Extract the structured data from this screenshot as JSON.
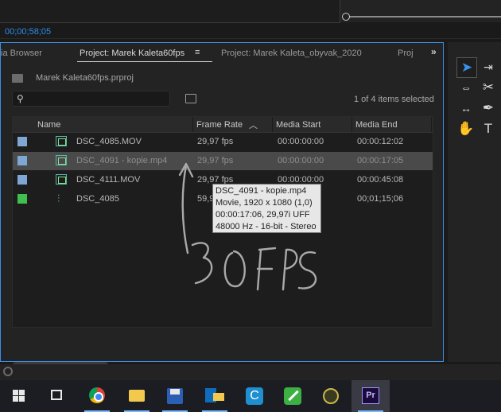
{
  "monitor": {
    "timecode": "00;00;58;05"
  },
  "project_panel": {
    "tabs": [
      {
        "label": "ia Browser"
      },
      {
        "label": "Project: Marek Kaleta60fps"
      },
      {
        "label": "Project: Marek Kaleta_obyvak_2020"
      },
      {
        "label": "Proj"
      }
    ],
    "tab_menu_glyph": "≡",
    "more_glyph": "»",
    "project_file": "Marek Kaleta60fps.prproj",
    "search_placeholder": "",
    "items_selected": "1 of 4 items selected",
    "columns": [
      "Name",
      "Frame Rate",
      "Media Start",
      "Media End"
    ],
    "sort_indicator": "^",
    "rows": [
      {
        "color": "#7fa7d6",
        "icon": "video-clip-icon",
        "name": "DSC_4085.MOV",
        "frame_rate": "29,97 fps",
        "media_start": "00:00:00:00",
        "media_end": "00:00:12:02",
        "selected": false
      },
      {
        "color": "#7fa7d6",
        "icon": "video-clip-icon",
        "name": "DSC_4091 - kopie.mp4",
        "frame_rate": "29,97 fps",
        "media_start": "00:00:00:00",
        "media_end": "00:00:17:05",
        "selected": true
      },
      {
        "color": "#7fa7d6",
        "icon": "video-clip-icon",
        "name": "DSC_4111.MOV",
        "frame_rate": "29,97 fps",
        "media_start": "00:00:00:00",
        "media_end": "00:00:45:08",
        "selected": false
      },
      {
        "color": "#3fbf4f",
        "icon": "sequence-icon",
        "name": "DSC_4085",
        "frame_rate": "59,9",
        "media_start": "",
        "media_end": "00;01;15;06",
        "selected": false
      }
    ],
    "tooltip": [
      "DSC_4091 - kopie.mp4",
      "Movie, 1920 x 1080 (1,0)",
      "00:00:17:06, 29,97i UFF",
      "48000 Hz - 16-bit - Stereo"
    ],
    "annotation_text": "30FPS"
  },
  "taskbar": {
    "apps": [
      "windows-start-icon",
      "task-view-icon",
      "chrome-icon",
      "file-explorer-icon",
      "save-app-icon",
      "outlook-icon",
      "ccleaner-icon",
      "green-app-icon",
      "globe-app-icon",
      "premiere-pro-icon"
    ],
    "premiere_label": "Pr"
  }
}
